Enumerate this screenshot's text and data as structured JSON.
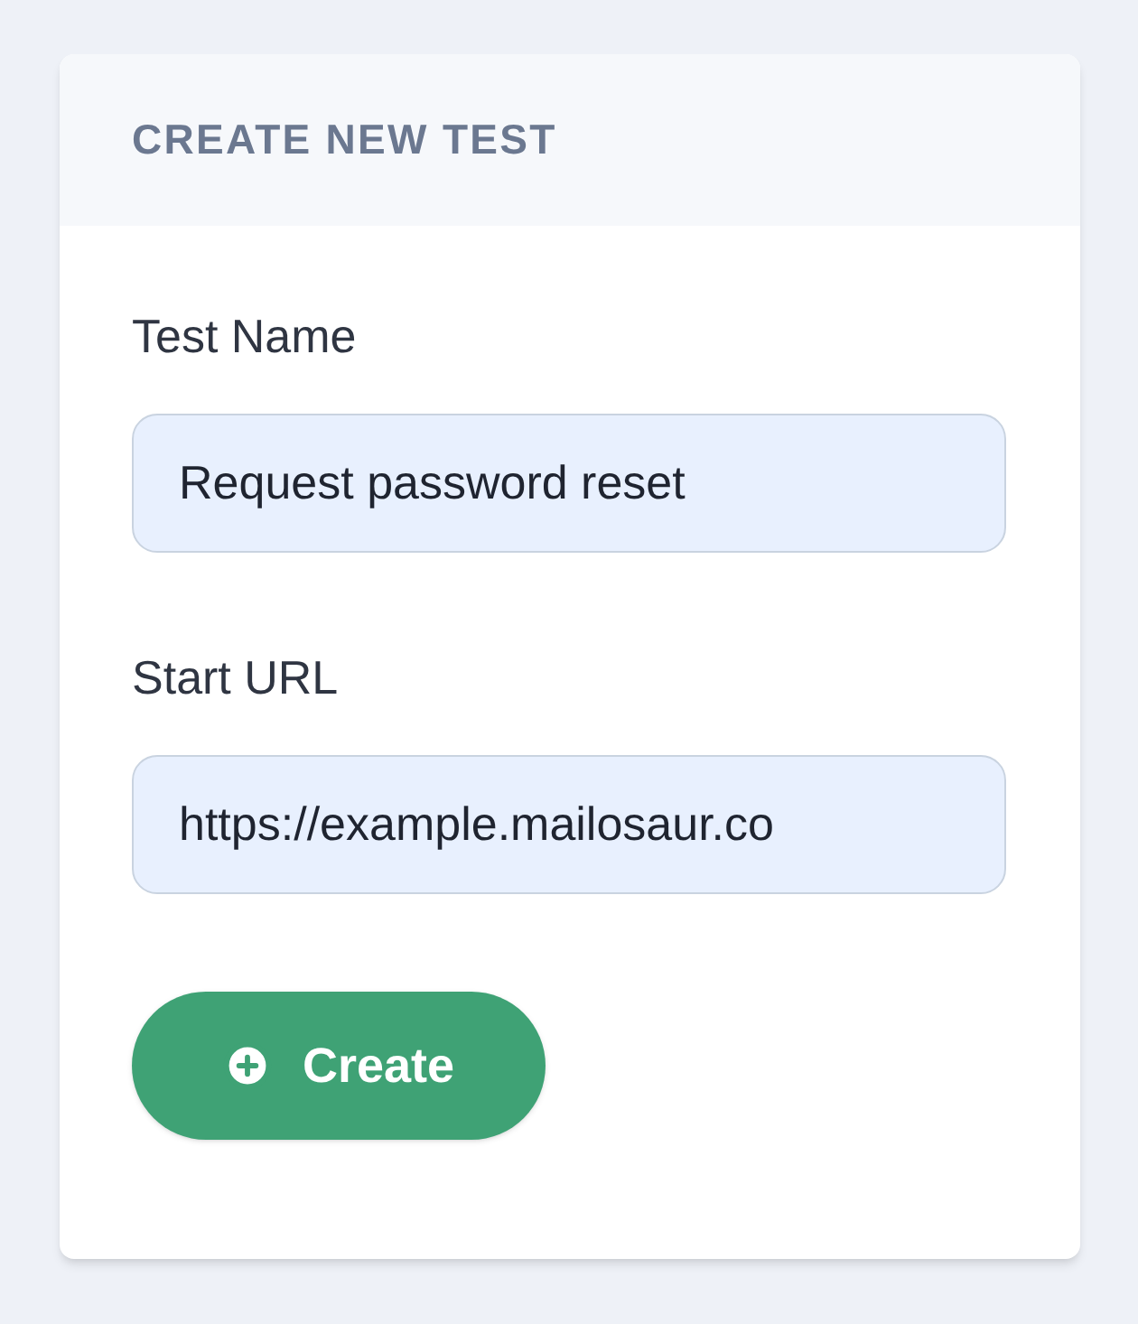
{
  "card": {
    "title": "CREATE NEW TEST"
  },
  "fields": [
    {
      "label": "Test Name",
      "value": "Request password reset"
    },
    {
      "label": "Start URL",
      "value": "https://example.mailosaur.co"
    }
  ],
  "button": {
    "label": "Create"
  }
}
